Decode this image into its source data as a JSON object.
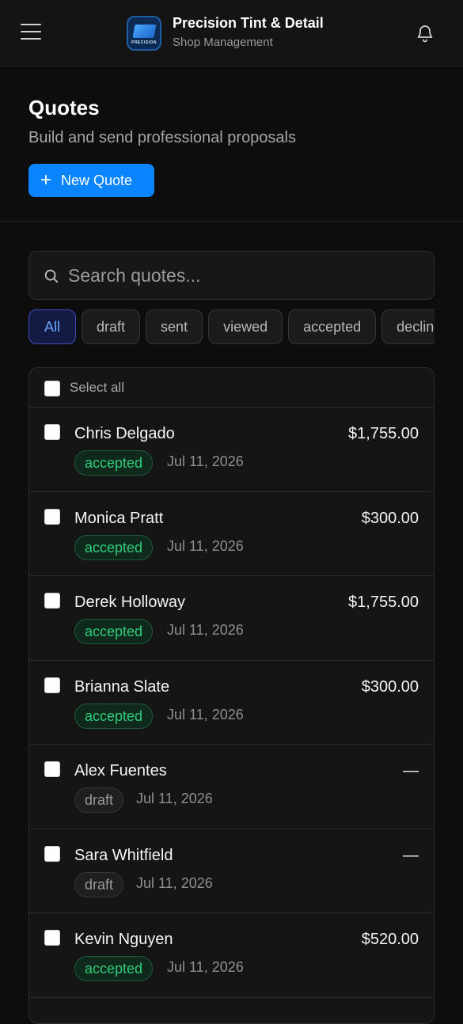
{
  "header": {
    "brand_name": "Precision Tint & Detail",
    "brand_sub": "Shop Management",
    "logo_text": "PRECISION",
    "icons": {
      "menu": "hamburger-menu-icon",
      "notifications": "bell-icon"
    }
  },
  "page": {
    "title": "Quotes",
    "subtitle": "Build and send professional proposals",
    "new_button_icon": "+",
    "new_button_label": "New Quote"
  },
  "search": {
    "placeholder": "Search quotes...",
    "value": ""
  },
  "filters": [
    "All",
    "draft",
    "sent",
    "viewed",
    "accepted",
    "declined"
  ],
  "active_filter": "All",
  "list": {
    "select_all_label": "Select all",
    "rows": [
      {
        "name": "Chris Delgado",
        "amount": "$1,755.00",
        "status": "accepted",
        "date": "Jul 11, 2026"
      },
      {
        "name": "Monica Pratt",
        "amount": "$300.00",
        "status": "accepted",
        "date": "Jul 11, 2026"
      },
      {
        "name": "Derek Holloway",
        "amount": "$1,755.00",
        "status": "accepted",
        "date": "Jul 11, 2026"
      },
      {
        "name": "Brianna Slate",
        "amount": "$300.00",
        "status": "accepted",
        "date": "Jul 11, 2026"
      },
      {
        "name": "Alex Fuentes",
        "amount": "—",
        "status": "draft",
        "date": "Jul 11, 2026"
      },
      {
        "name": "Sara Whitfield",
        "amount": "—",
        "status": "draft",
        "date": "Jul 11, 2026"
      },
      {
        "name": "Kevin Nguyen",
        "amount": "$520.00",
        "status": "accepted",
        "date": "Jul 11, 2026"
      }
    ]
  },
  "colors": {
    "accent": "#0a84ff",
    "accepted": "#2fcc7a",
    "background": "#0d0d0d"
  }
}
